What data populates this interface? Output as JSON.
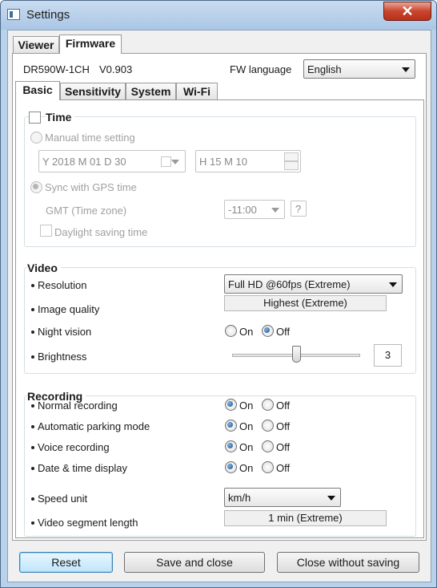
{
  "window": {
    "title": "Settings",
    "close_glyph": "✕"
  },
  "top_tabs": [
    {
      "label": "Viewer"
    },
    {
      "label": "Firmware"
    }
  ],
  "firmware": {
    "model": "DR590W-1CH",
    "version": "V0.903",
    "fw_language_label": "FW language",
    "fw_language_value": "English"
  },
  "sub_tabs": [
    {
      "label": "Basic"
    },
    {
      "label": "Sensitivity"
    },
    {
      "label": "System"
    },
    {
      "label": "Wi-Fi"
    }
  ],
  "time": {
    "title": "Time",
    "checked": false,
    "manual_label": "Manual time setting",
    "date_value": "Y 2018 M 01 D 30",
    "time_value": "H 15 M 10",
    "gps_label": "Sync with GPS time",
    "gmt_label": "GMT (Time zone)",
    "gmt_value": "-11:00",
    "help_label": "?",
    "dst_label": "Daylight saving time"
  },
  "video": {
    "title": "Video",
    "resolution_label": "Resolution",
    "resolution_value": "Full HD @60fps (Extreme)",
    "quality_label": "Image quality",
    "quality_value": "Highest (Extreme)",
    "night_label": "Night vision",
    "night_on": "On",
    "night_off": "Off",
    "night_selected": "Off",
    "brightness_label": "Brightness",
    "brightness_value": "3",
    "brightness_level_fraction": 0.5
  },
  "recording": {
    "title": "Recording",
    "rows": [
      {
        "label": "Normal recording",
        "on": "On",
        "off": "Off",
        "selected": "On"
      },
      {
        "label": "Automatic parking mode",
        "on": "On",
        "off": "Off",
        "selected": "On"
      },
      {
        "label": "Voice recording",
        "on": "On",
        "off": "Off",
        "selected": "On"
      },
      {
        "label": "Date & time display",
        "on": "On",
        "off": "Off",
        "selected": "On"
      }
    ],
    "speed_label": "Speed unit",
    "speed_value": "km/h",
    "segment_label": "Video segment length",
    "segment_value": "1 min  (Extreme)"
  },
  "buttons": {
    "reset": "Reset",
    "save": "Save and close",
    "close": "Close without saving"
  }
}
